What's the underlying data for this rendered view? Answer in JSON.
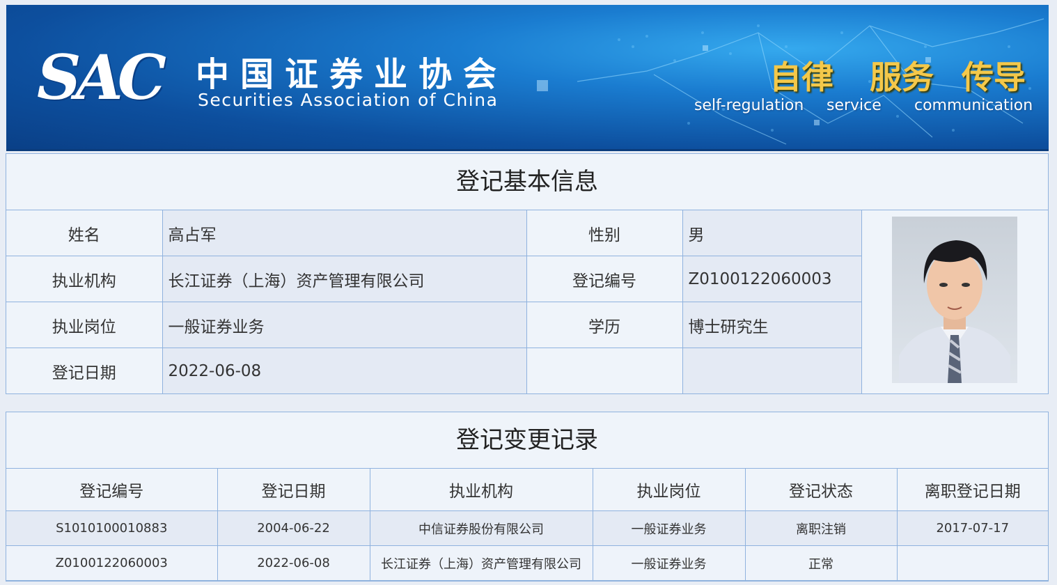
{
  "header": {
    "logo": "SAC",
    "org_name_cn": "中国证券业协会",
    "org_name_en": "Securities Association of China",
    "slogans": [
      {
        "cn": "自律",
        "en": "self-regulation"
      },
      {
        "cn": "服务",
        "en": "service"
      },
      {
        "cn": "传导",
        "en": "communication"
      }
    ]
  },
  "basic_info": {
    "title": "登记基本信息",
    "rows": [
      {
        "l1": "姓名",
        "v1": "高占军",
        "l2": "性别",
        "v2": "男"
      },
      {
        "l1": "执业机构",
        "v1": "长江证券（上海）资产管理有限公司",
        "l2": "登记编号",
        "v2": "Z0100122060003"
      },
      {
        "l1": "执业岗位",
        "v1": "一般证券业务",
        "l2": "学历",
        "v2": "博士研究生"
      },
      {
        "l1": "登记日期",
        "v1": "2022-06-08",
        "l2": "",
        "v2": ""
      }
    ]
  },
  "change_records": {
    "title": "登记变更记录",
    "columns": [
      "登记编号",
      "登记日期",
      "执业机构",
      "执业岗位",
      "登记状态",
      "离职登记日期"
    ],
    "rows": [
      [
        "S1010100010883",
        "2004-06-22",
        "中信证券股份有限公司",
        "一般证券业务",
        "离职注销",
        "2017-07-17"
      ],
      [
        "Z0100122060003",
        "2022-06-08",
        "长江证券（上海）资产管理有限公司",
        "一般证券业务",
        "正常",
        ""
      ]
    ]
  },
  "colors": {
    "border": "#8fb2de",
    "banner_blue": "#1a7cd0",
    "slogan_gold": "#f4c84a"
  }
}
